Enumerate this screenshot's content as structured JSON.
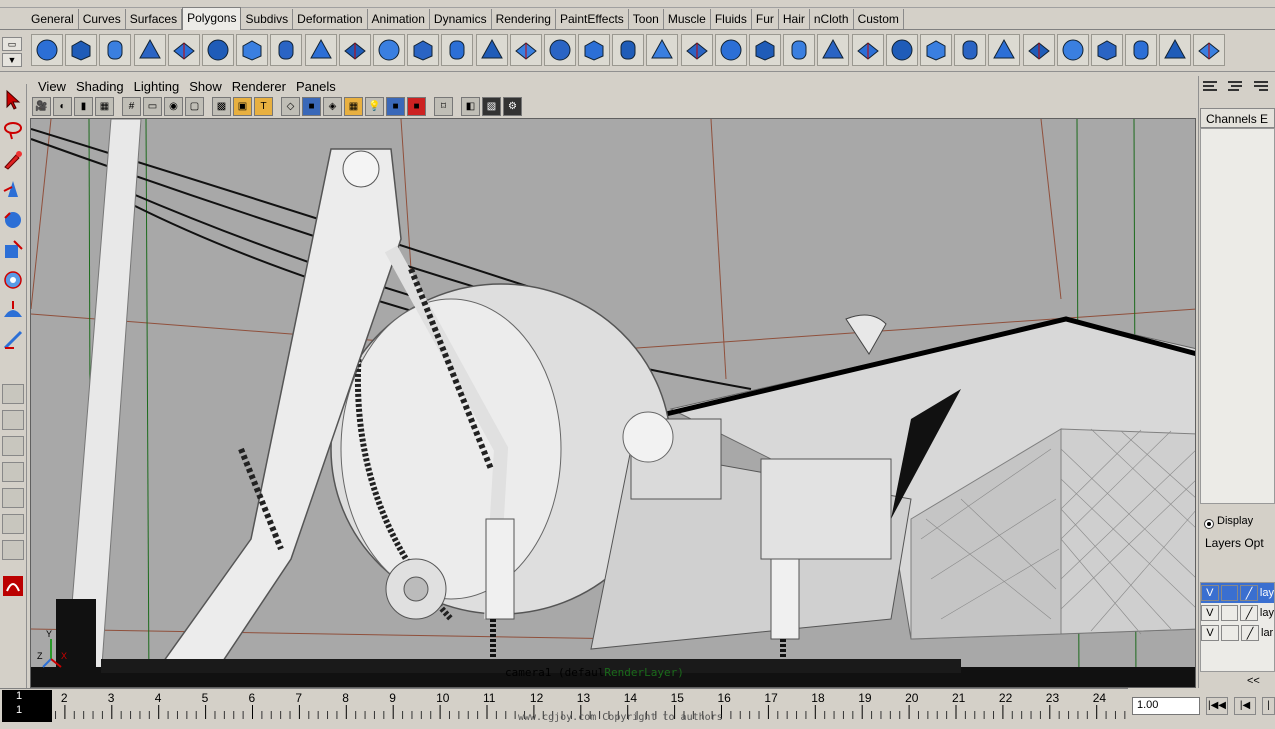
{
  "shelf_tabs": [
    "General",
    "Curves",
    "Surfaces",
    "Polygons",
    "Subdivs",
    "Deformation",
    "Animation",
    "Dynamics",
    "Rendering",
    "PaintEffects",
    "Toon",
    "Muscle",
    "Fluids",
    "Fur",
    "Hair",
    "nCloth",
    "Custom"
  ],
  "active_shelf_tab": "Polygons",
  "panel_menu": [
    "View",
    "Shading",
    "Lighting",
    "Show",
    "Renderer",
    "Panels"
  ],
  "viewport": {
    "camera_label_prefix": "camera1 (defaul",
    "camera_label_layer": "RenderLayer)",
    "axis_labels": {
      "y": "Y",
      "z": "Z",
      "x": "X"
    }
  },
  "right_panel": {
    "channels_tab": "Channels  E",
    "display_label": "Display",
    "layers_label": "Layers  Opt",
    "collapse": "<<",
    "layers": [
      {
        "visibility": "V",
        "name": "lay",
        "selected": true
      },
      {
        "visibility": "V",
        "name": "lay",
        "selected": false
      },
      {
        "visibility": "V",
        "name": "lar",
        "selected": false
      }
    ]
  },
  "timeline": {
    "frames": [
      "1",
      "2",
      "3",
      "4",
      "5",
      "6",
      "7",
      "8",
      "9",
      "10",
      "11",
      "12",
      "13",
      "14",
      "15",
      "16",
      "17",
      "18",
      "19",
      "20",
      "21",
      "22",
      "23",
      "24"
    ],
    "current_frame": "1",
    "current_frame_sub": "1",
    "watermark": "www.cgjoy.com  Copyright to authors",
    "frame_field": "1.00"
  },
  "colors": {
    "ui_bg": "#d4d0c8",
    "viewport_bg": "#a8a8a8",
    "layer_selected": "#3a6fd0",
    "shelf_blue": "#2c6fd6"
  }
}
